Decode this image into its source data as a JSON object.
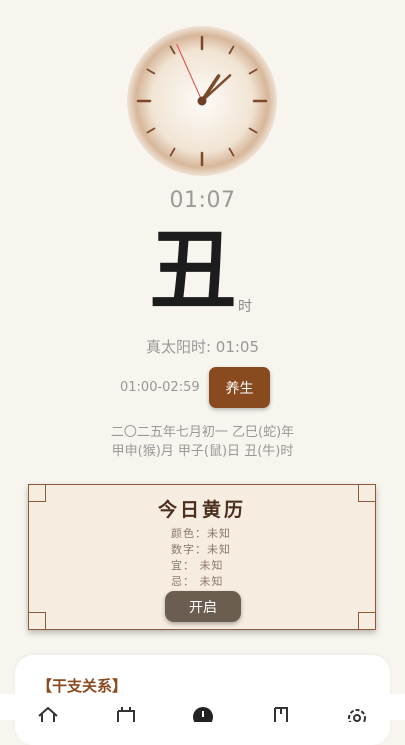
{
  "clock": {
    "hour": 1,
    "minute": 7,
    "second": 56
  },
  "time": "01:07",
  "shichen": "丑",
  "shichen_suffix": "时",
  "true_solar_time": "真太阳时: 01:05",
  "time_range": "01:00-02:59",
  "yangsheng_button": "养生",
  "lunar_date": "二〇二五年七月初一 乙巳(蛇)年",
  "ganzhi_date": "甲申(猴)月 甲子(鼠)日 丑(牛)时",
  "almanac": {
    "title": "今日黄历",
    "rows": [
      "颜色：未知",
      "数字：未知",
      "宜： 未知",
      "忌： 未知"
    ],
    "button": "开启"
  },
  "ganzhi_section_title": "【干支关系】",
  "tabs": [
    {
      "name": "home-icon"
    },
    {
      "name": "calendar-icon"
    },
    {
      "name": "clock-icon",
      "active": true
    },
    {
      "name": "book-icon"
    },
    {
      "name": "settings-icon"
    }
  ],
  "colors": {
    "accent": "#8a4a1f",
    "background": "#f8f5ef",
    "card": "#f6ece0",
    "button_gray": "#6b5d4f"
  }
}
